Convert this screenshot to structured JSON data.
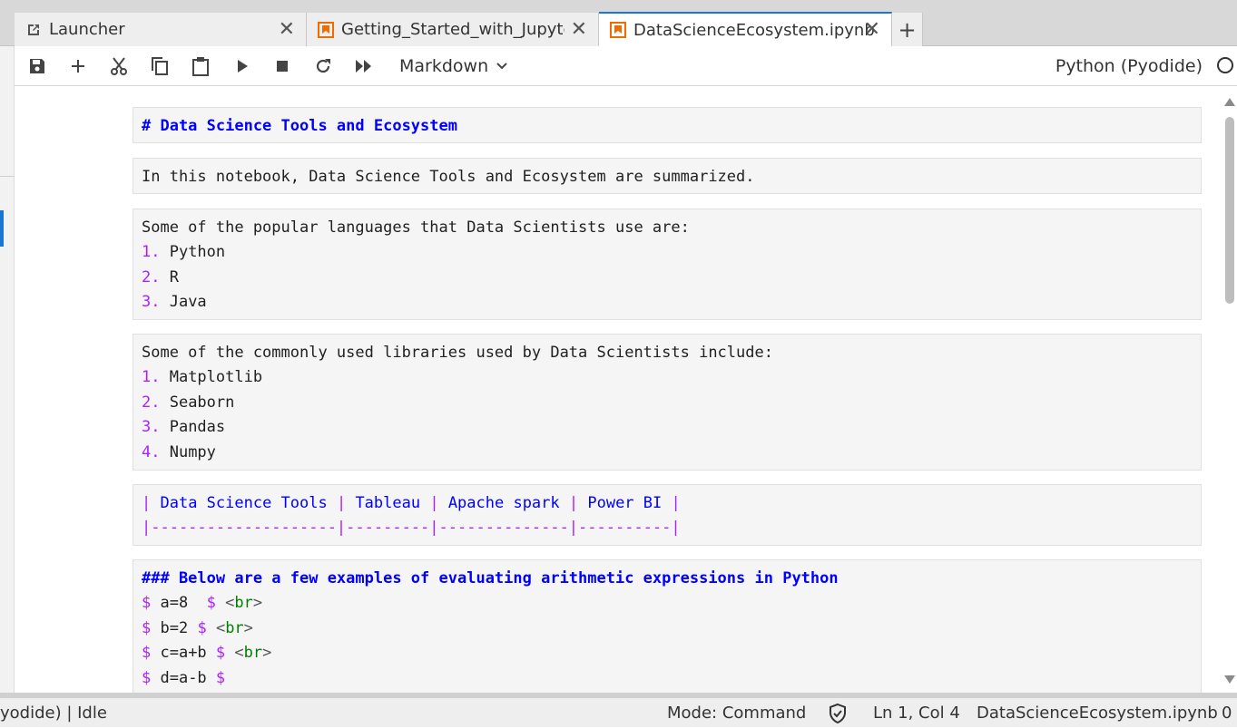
{
  "tabs": [
    {
      "label": "Launcher",
      "icon": "external-link-icon",
      "active": false
    },
    {
      "label": "Getting_Started_with_Jupyter",
      "icon": "notebook-icon",
      "active": false
    },
    {
      "label": "DataScienceEcosystem.ipynb",
      "icon": "notebook-icon",
      "active": true
    }
  ],
  "toolbar": {
    "cell_type": "Markdown",
    "kernel_name": "Python (Pyodide)"
  },
  "cells": {
    "c1": {
      "text": "# Data Science Tools and Ecosystem"
    },
    "c2": {
      "text": "In this notebook, Data Science Tools and Ecosystem are summarized."
    },
    "c3": {
      "intro": "Some of the popular languages that Data Scientists use are:",
      "items": [
        {
          "num": "1.",
          "text": " Python"
        },
        {
          "num": "2.",
          "text": " R"
        },
        {
          "num": "3.",
          "text": " Java"
        }
      ]
    },
    "c4": {
      "intro": "Some of the commonly used libraries used by Data Scientists include:",
      "items": [
        {
          "num": "1.",
          "text": " Matplotlib"
        },
        {
          "num": "2.",
          "text": " Seaborn"
        },
        {
          "num": "3.",
          "text": " Pandas"
        },
        {
          "num": "4.",
          "text": " Numpy"
        }
      ]
    },
    "c5": {
      "pipe": "|",
      "headers": [
        " Data Science Tools ",
        " Tableau ",
        " Apache spark ",
        " Power BI "
      ],
      "separator": "|--------------------|---------|--------------|----------|"
    },
    "c6": {
      "heading": "### Below are a few examples of evaluating arithmetic expressions in Python",
      "dollar": "$",
      "lt": "<",
      "br": "br",
      "gt": ">",
      "lines": [
        {
          "expr": " a=8  ",
          "has_br": true
        },
        {
          "expr": " b=2 ",
          "has_br": true
        },
        {
          "expr": " c=a+b ",
          "has_br": true
        },
        {
          "expr": " d=a-b ",
          "has_br": false
        }
      ]
    }
  },
  "statusbar": {
    "kernel_state": "yodide) | Idle",
    "mode": "Mode: Command",
    "cursor": "Ln 1, Col 4",
    "filename": "DataScienceEcosystem.ipynb",
    "count": "0"
  }
}
